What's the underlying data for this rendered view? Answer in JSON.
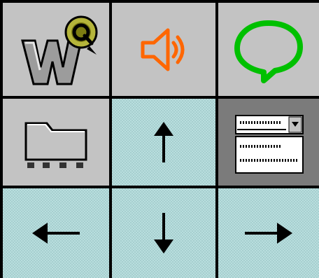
{
  "grid": {
    "cells": [
      {
        "name": "wq-app-icon",
        "bg": "gray"
      },
      {
        "name": "speaker-icon",
        "bg": "gray"
      },
      {
        "name": "speech-bubble-icon",
        "bg": "gray"
      },
      {
        "name": "folder-icon",
        "bg": "gray"
      },
      {
        "name": "arrow-up-icon",
        "bg": "teal"
      },
      {
        "name": "dropdown-list-icon",
        "bg": "dark"
      },
      {
        "name": "arrow-left-icon",
        "bg": "teal"
      },
      {
        "name": "arrow-down-icon",
        "bg": "teal"
      },
      {
        "name": "arrow-right-icon",
        "bg": "teal"
      }
    ]
  },
  "colors": {
    "cell_gray": "#c3c3c3",
    "cell_dark": "#7b7b7b",
    "cell_teal": "#b9dede",
    "speaker_orange": "#ff6600",
    "bubble_green": "#00c000",
    "q_badge_olive": "#b5b53b",
    "grid_line": "#000000"
  }
}
